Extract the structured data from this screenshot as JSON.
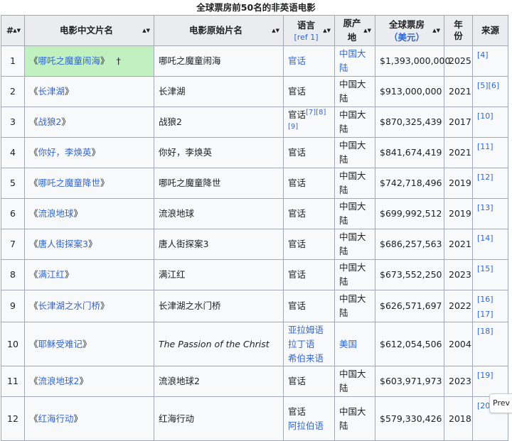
{
  "caption": "全球票房前50名的非英语电影",
  "headers": {
    "rank": "#",
    "cn_title": "电影中文片名",
    "orig_title": "电影原始片名",
    "language": "语言",
    "language_ref": "[ref 1]",
    "origin": "原产地",
    "gross": "全球票房",
    "gross_unit": "（美元）",
    "year_l1": "年",
    "year_l2": "份",
    "source": "来源"
  },
  "rows": [
    {
      "rank": "1",
      "cn_title": "哪吒之魔童闹海",
      "marker": "†",
      "orig_title": "哪吒之魔童闹海",
      "language": [
        "官话"
      ],
      "language_linked": true,
      "lang_refs": "",
      "origin": "中国大陆",
      "origin_linked": true,
      "gross": "$1,393,000,000",
      "year": "2025",
      "refs": "[4]"
    },
    {
      "rank": "2",
      "cn_title": "长津湖",
      "marker": "",
      "orig_title": "长津湖",
      "language": [
        "官话"
      ],
      "language_linked": false,
      "lang_refs": "",
      "origin": "中国大陆",
      "origin_linked": false,
      "gross": "$913,000,000",
      "year": "2021",
      "refs": "[5][6]"
    },
    {
      "rank": "3",
      "cn_title": "战狼2",
      "marker": "",
      "orig_title": "战狼2",
      "language": [
        "官话"
      ],
      "language_linked": false,
      "lang_refs": "[7][8][9]",
      "origin": "中国大陆",
      "origin_linked": false,
      "gross": "$870,325,439",
      "year": "2017",
      "refs": "[10]"
    },
    {
      "rank": "4",
      "cn_title": "你好，李焕英",
      "marker": "",
      "orig_title": "你好，李焕英",
      "language": [
        "官话"
      ],
      "language_linked": false,
      "lang_refs": "",
      "origin": "中国大陆",
      "origin_linked": false,
      "gross": "$841,674,419",
      "year": "2021",
      "refs": "[11]"
    },
    {
      "rank": "5",
      "cn_title": "哪吒之魔童降世",
      "marker": "",
      "orig_title": "哪吒之魔童降世",
      "language": [
        "官话"
      ],
      "language_linked": false,
      "lang_refs": "",
      "origin": "中国大陆",
      "origin_linked": false,
      "gross": "$742,718,496",
      "year": "2019",
      "refs": "[12]"
    },
    {
      "rank": "6",
      "cn_title": "流浪地球",
      "marker": "",
      "orig_title": "流浪地球",
      "language": [
        "官话"
      ],
      "language_linked": false,
      "lang_refs": "",
      "origin": "中国大陆",
      "origin_linked": false,
      "gross": "$699,992,512",
      "year": "2019",
      "refs": "[13]"
    },
    {
      "rank": "7",
      "cn_title": "唐人街探案3",
      "marker": "",
      "orig_title": "唐人街探案3",
      "language": [
        "官话"
      ],
      "language_linked": false,
      "lang_refs": "",
      "origin": "中国大陆",
      "origin_linked": false,
      "gross": "$686,257,563",
      "year": "2021",
      "refs": "[14]"
    },
    {
      "rank": "8",
      "cn_title": "满江红",
      "marker": "",
      "orig_title": "满江红",
      "language": [
        "官话"
      ],
      "language_linked": false,
      "lang_refs": "",
      "origin": "中国大陆",
      "origin_linked": false,
      "gross": "$673,552,250",
      "year": "2023",
      "refs": "[15]"
    },
    {
      "rank": "9",
      "cn_title": "长津湖之水门桥",
      "marker": "",
      "orig_title": "长津湖之水门桥",
      "language": [
        "官话"
      ],
      "language_linked": false,
      "lang_refs": "",
      "origin": "中国大陆",
      "origin_linked": false,
      "gross": "$626,571,697",
      "year": "2022",
      "refs": "[16][17]"
    },
    {
      "rank": "10",
      "cn_title": "耶稣受难记",
      "marker": "",
      "orig_title": "The Passion of the Christ",
      "orig_italic": true,
      "language": [
        "亚拉姆语",
        "拉丁语",
        "希伯来语"
      ],
      "language_linked": true,
      "lang_refs": "",
      "origin": "美国",
      "origin_linked": true,
      "gross": "$612,054,506",
      "year": "2004",
      "refs": "[18]"
    },
    {
      "rank": "11",
      "cn_title": "流浪地球2",
      "marker": "",
      "orig_title": "流浪地球2",
      "language": [
        "官话"
      ],
      "language_linked": false,
      "lang_refs": "",
      "origin": "中国大陆",
      "origin_linked": false,
      "gross": "$603,971,973",
      "year": "2023",
      "refs": "[19]"
    },
    {
      "rank": "12",
      "cn_title": "红海行动",
      "marker": "",
      "orig_title": "红海行动",
      "language": [
        "官话",
        "阿拉伯语"
      ],
      "language_linked": false,
      "lang_partial_link": 1,
      "lang_refs": "",
      "origin": "中国大陆",
      "origin_linked": false,
      "gross": "$579,330,426",
      "year": "2018",
      "refs": "[20]"
    }
  ],
  "prev_tab": "Prev"
}
